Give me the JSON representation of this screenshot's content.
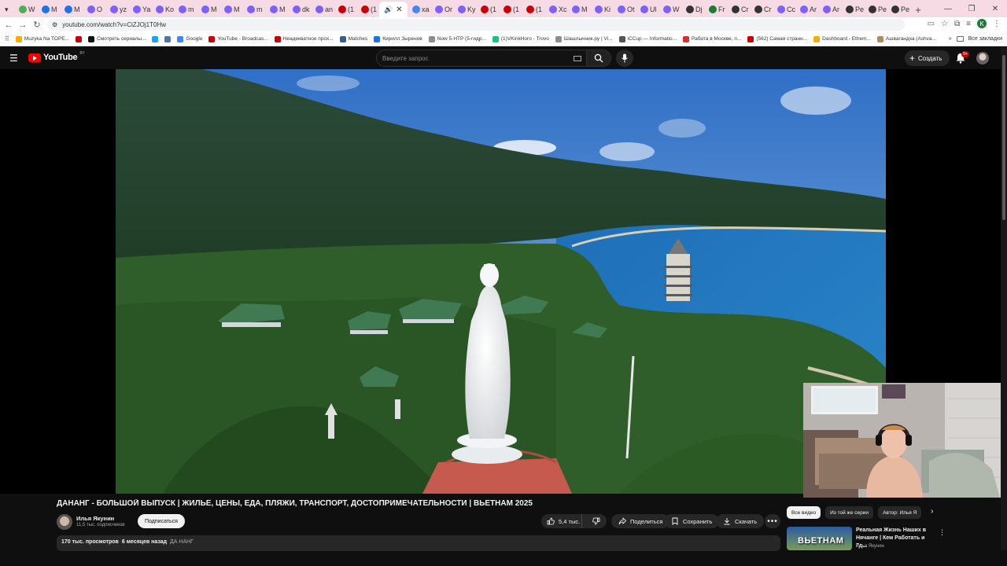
{
  "browser": {
    "tabs": [
      {
        "label": "W",
        "color": "#4caf50"
      },
      {
        "label": "M",
        "color": "#1a73e8"
      },
      {
        "label": "M",
        "color": "#1a73e8"
      },
      {
        "label": "O",
        "color": "#7b61ff"
      },
      {
        "label": "yz",
        "color": "#7b61ff"
      },
      {
        "label": "Ya",
        "color": "#7b61ff"
      },
      {
        "label": "Ko",
        "color": "#7b61ff"
      },
      {
        "label": "m",
        "color": "#7b61ff"
      },
      {
        "label": "M",
        "color": "#7b61ff"
      },
      {
        "label": "M",
        "color": "#7b61ff"
      },
      {
        "label": "m",
        "color": "#7b61ff"
      },
      {
        "label": "M",
        "color": "#7b61ff"
      },
      {
        "label": "dk",
        "color": "#7b61ff"
      },
      {
        "label": "an",
        "color": "#7b61ff"
      },
      {
        "label": "(1",
        "color": "#cc0000"
      },
      {
        "label": "(1",
        "color": "#cc0000"
      }
    ],
    "tabs_after": [
      {
        "label": "xa",
        "color": "#4285f4"
      },
      {
        "label": "Or",
        "color": "#7b61ff"
      },
      {
        "label": "Ky",
        "color": "#7b61ff"
      },
      {
        "label": "(1",
        "color": "#cc0000"
      },
      {
        "label": "(1",
        "color": "#cc0000"
      },
      {
        "label": "(1",
        "color": "#cc0000"
      },
      {
        "label": "Xc",
        "color": "#7b61ff"
      },
      {
        "label": "M",
        "color": "#7b61ff"
      },
      {
        "label": "Ki",
        "color": "#7b61ff"
      },
      {
        "label": "Ot",
        "color": "#7b61ff"
      },
      {
        "label": "Ul",
        "color": "#7b61ff"
      },
      {
        "label": "W",
        "color": "#7b61ff"
      },
      {
        "label": "Dj",
        "color": "#333333"
      },
      {
        "label": "Fr",
        "color": "#1e7b34"
      },
      {
        "label": "Cr",
        "color": "#333333"
      },
      {
        "label": "Cr",
        "color": "#333333"
      },
      {
        "label": "Cc",
        "color": "#7b61ff"
      },
      {
        "label": "Ar",
        "color": "#7b61ff"
      },
      {
        "label": "Ar",
        "color": "#7b61ff"
      },
      {
        "label": "Pe",
        "color": "#333333"
      },
      {
        "label": "Pe",
        "color": "#333333"
      },
      {
        "label": "Pe",
        "color": "#333333"
      }
    ],
    "active_tab_icon": "speaker-icon",
    "url": "youtube.com/watch?v=CiZJOj1T0Hw",
    "profile_letter": "K",
    "bookmarks": [
      {
        "label": "Muzyka Na TOPE...",
        "color": "#f9ab00"
      },
      {
        "label": "",
        "color": "#cc0000"
      },
      {
        "label": "Смотреть сериалы...",
        "color": "#111111"
      },
      {
        "label": "",
        "color": "#1da1f2"
      },
      {
        "label": "",
        "color": "#4a76a8"
      },
      {
        "label": "Google",
        "color": "#4285f4"
      },
      {
        "label": "YouTube - Broadcas...",
        "color": "#cc0000"
      },
      {
        "label": "Неадекватное прох...",
        "color": "#cc0000"
      },
      {
        "label": "Matches",
        "color": "#3b5998"
      },
      {
        "label": "Кирилл Зыренов",
        "color": "#1a73e8"
      },
      {
        "label": "Now 5-HTP (5-гидр...",
        "color": "#8e8e8e"
      },
      {
        "label": "(1)VKinkHoro - Trovo",
        "color": "#19c37d"
      },
      {
        "label": "Шашлычник.ру | Vi...",
        "color": "#8e8e8e"
      },
      {
        "label": "iCCup — Informatio...",
        "color": "#555555"
      },
      {
        "label": "Работа в Москве, п...",
        "color": "#d93025"
      },
      {
        "label": "(562) Самая странн...",
        "color": "#cc0000"
      },
      {
        "label": "Dashboard - Ethem...",
        "color": "#f9ab00"
      },
      {
        "label": "Ашвагандха (Ashva...",
        "color": "#b08d57"
      }
    ],
    "all_bookmarks": "Все закладки"
  },
  "youtube": {
    "logo_text": "YouTube",
    "region": "BY",
    "search_placeholder": "Введите запрос",
    "create_label": "Создать",
    "notifications_badge": "9+"
  },
  "video": {
    "title": "ДАНАНГ - БОЛЬШОЙ ВЫПУСК | ЖИЛЬЕ, ЦЕНЫ, ЕДА, ПЛЯЖИ, ТРАНСПОРТ, ДОСТОПРИМЕЧАТЕЛЬНОСТИ | ВЬЕТНАМ 2025",
    "channel_name": "Илья Якунин",
    "channel_subs": "11,5 тыс. подписчиков",
    "subscribe_label": "Подписаться",
    "likes": "5,4 тыс.",
    "share_label": "Поделиться",
    "save_label": "Сохранить",
    "download_label": "Скачать",
    "views": "170 тыс. просмотров",
    "published": "6 месяцев назад",
    "tag": "ДА НАНГ"
  },
  "sidebar": {
    "chips": [
      "Все видео",
      "Из той же серии",
      "Автор: Илья Я"
    ],
    "recommendation": {
      "thumb_text": "ВЬЕТНАМ",
      "title": "Реальная Жизнь Наших в Нячанге | Кем Работать и Гд...",
      "author": "Илья Якунин"
    }
  },
  "colors": {
    "accent_red": "#ff0000",
    "bg": "#0f0f0f",
    "tab_strip": "#f6dbe5"
  }
}
